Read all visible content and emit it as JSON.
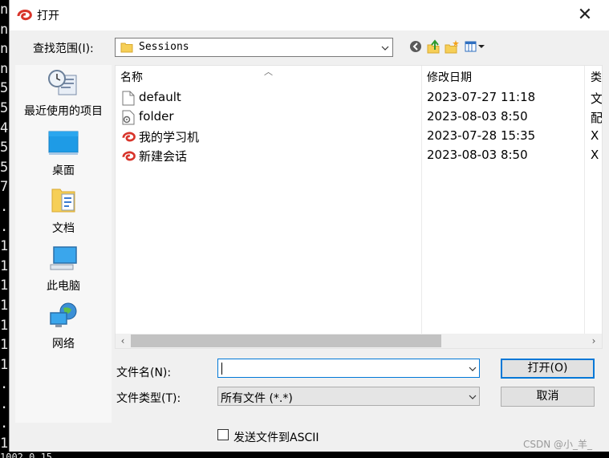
{
  "terminal": {
    "lines": [
      "n",
      "n",
      "n",
      "n",
      "5",
      "5",
      "4",
      "5",
      "5",
      "7",
      ".",
      ".",
      "1",
      "1",
      "1",
      "1",
      "1",
      "1",
      "1",
      ".",
      ".",
      ".",
      "1"
    ],
    "bottom_text": "1002 0 15"
  },
  "title": "打开",
  "lookin": {
    "label": "查找范围(I):",
    "value": "Sessions"
  },
  "places": [
    {
      "label": "最近使用的项目",
      "icon": "recent-items-icon"
    },
    {
      "label": "桌面",
      "icon": "desktop-icon"
    },
    {
      "label": "文档",
      "icon": "documents-icon"
    },
    {
      "label": "此电脑",
      "icon": "this-pc-icon"
    },
    {
      "label": "网络",
      "icon": "network-icon"
    }
  ],
  "columns": {
    "name": "名称",
    "modified": "修改日期",
    "type": "类"
  },
  "files": [
    {
      "name": "default",
      "modified": "2023-07-27 11:18",
      "type": "文",
      "icon": "file-icon"
    },
    {
      "name": "folder",
      "modified": "2023-08-03 8:50",
      "type": "配",
      "icon": "settings-file-icon"
    },
    {
      "name": "我的学习机",
      "modified": "2023-07-28 15:35",
      "type": "X",
      "icon": "session-icon"
    },
    {
      "name": "新建会话",
      "modified": "2023-08-03 8:50",
      "type": "X",
      "icon": "session-icon"
    }
  ],
  "filename": {
    "label": "文件名(N):",
    "value": ""
  },
  "filetype": {
    "label": "文件类型(T):",
    "value": "所有文件 (*.*)"
  },
  "buttons": {
    "open": "打开(O)",
    "cancel": "取消"
  },
  "ascii_checkbox": {
    "label": "发送文件到ASCII",
    "checked": false
  },
  "watermark": "CSDN @小_羊_",
  "colors": {
    "accent": "#0078d7",
    "session_red": "#d8342a"
  }
}
